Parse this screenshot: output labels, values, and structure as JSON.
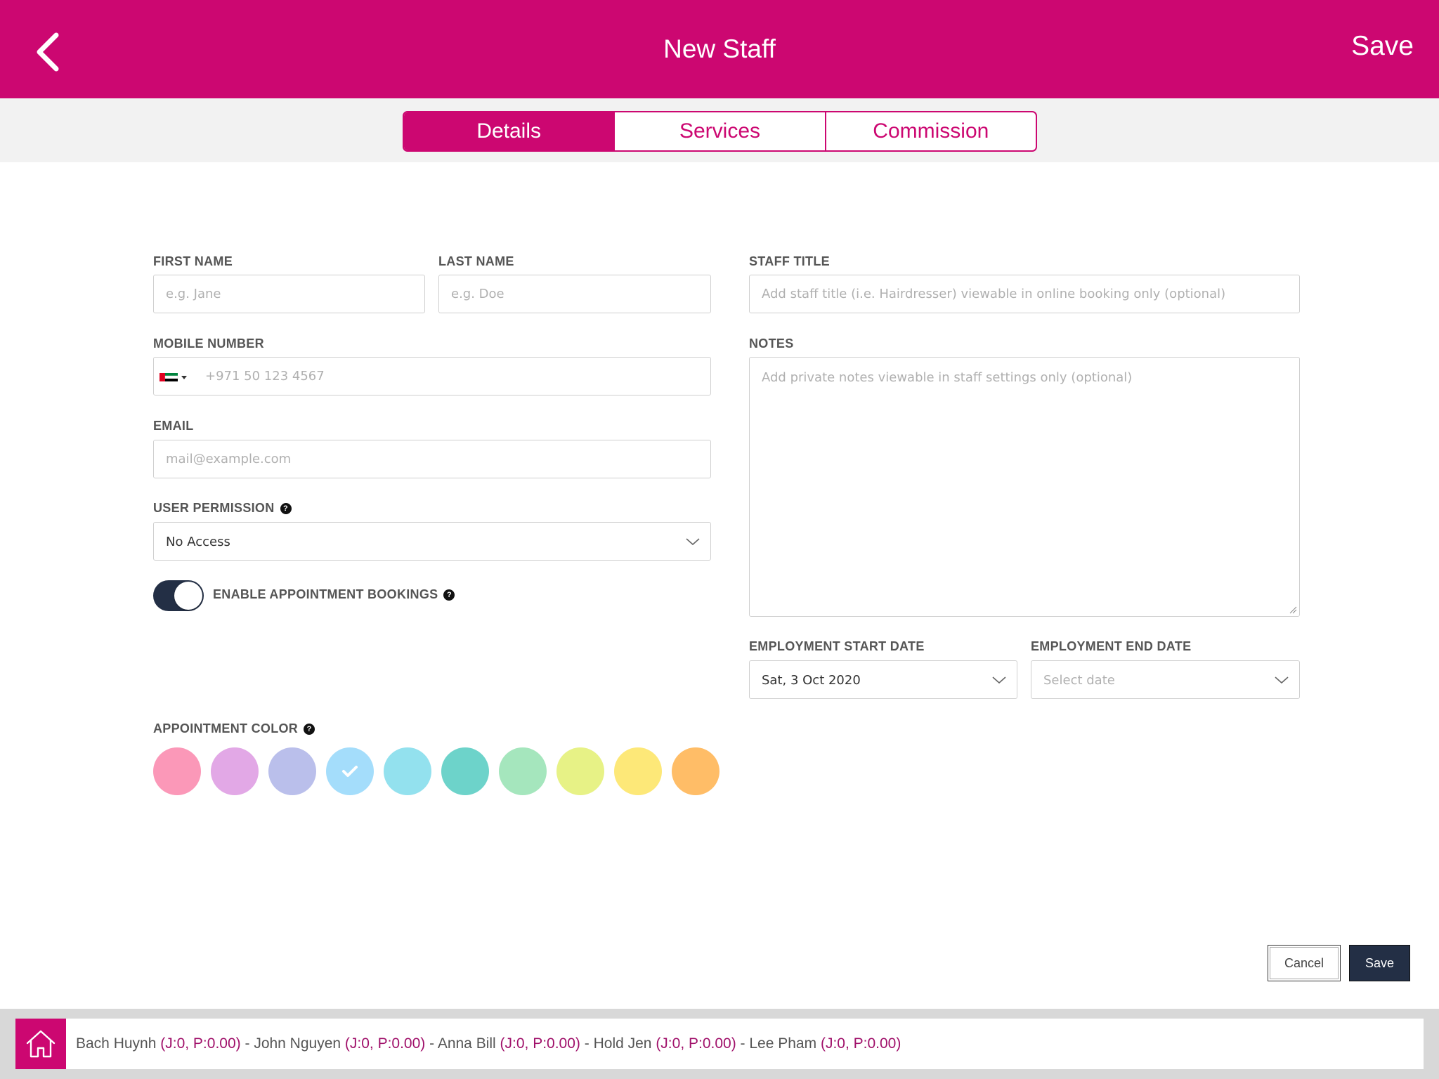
{
  "header": {
    "title": "New Staff",
    "save_label": "Save",
    "color": "#cc0771"
  },
  "tabs": [
    {
      "label": "Details",
      "active": true
    },
    {
      "label": "Services",
      "active": false
    },
    {
      "label": "Commission",
      "active": false
    }
  ],
  "form": {
    "first_name": {
      "label": "FIRST NAME",
      "placeholder": "e.g. Jane",
      "value": ""
    },
    "last_name": {
      "label": "LAST NAME",
      "placeholder": "e.g. Doe",
      "value": ""
    },
    "mobile": {
      "label": "MOBILE NUMBER",
      "placeholder": "+971 50 123 4567",
      "value": "",
      "country_icon": "uae-flag-icon"
    },
    "email": {
      "label": "EMAIL",
      "placeholder": "mail@example.com",
      "value": ""
    },
    "user_permission": {
      "label": "USER PERMISSION",
      "value": "No Access"
    },
    "enable_bookings": {
      "label": "ENABLE APPOINTMENT BOOKINGS",
      "on": true
    },
    "appointment_color": {
      "label": "APPOINTMENT COLOR",
      "colors": [
        "#fb98b8",
        "#e2a8e6",
        "#babfeb",
        "#a4ddfb",
        "#93e1ee",
        "#6dd3ca",
        "#a5e6bd",
        "#e7f286",
        "#fde878",
        "#ffbd67"
      ],
      "selected_index": 3
    },
    "staff_title": {
      "label": "STAFF TITLE",
      "placeholder": "Add staff title (i.e. Hairdresser) viewable in online booking only (optional)",
      "value": ""
    },
    "notes": {
      "label": "NOTES",
      "placeholder": "Add private notes viewable in staff settings only (optional)",
      "value": ""
    },
    "start_date": {
      "label": "EMPLOYMENT START DATE",
      "value": "Sat, 3 Oct 2020"
    },
    "end_date": {
      "label": "EMPLOYMENT END DATE",
      "placeholder": "Select date"
    }
  },
  "actions": {
    "cancel_label": "Cancel",
    "save_label": "Save"
  },
  "footer": {
    "staff": [
      {
        "name": "Bach Huynh",
        "stats": "(J:0, P:0.00)"
      },
      {
        "name": "John Nguyen",
        "stats": "(J:0, P:0.00)"
      },
      {
        "name": "Anna Bill",
        "stats": "(J:0, P:0.00)"
      },
      {
        "name": "Hold Jen",
        "stats": "(J:0, P:0.00)"
      },
      {
        "name": "Lee Pham",
        "stats": "(J:0, P:0.00)"
      }
    ],
    "separator": " - "
  }
}
